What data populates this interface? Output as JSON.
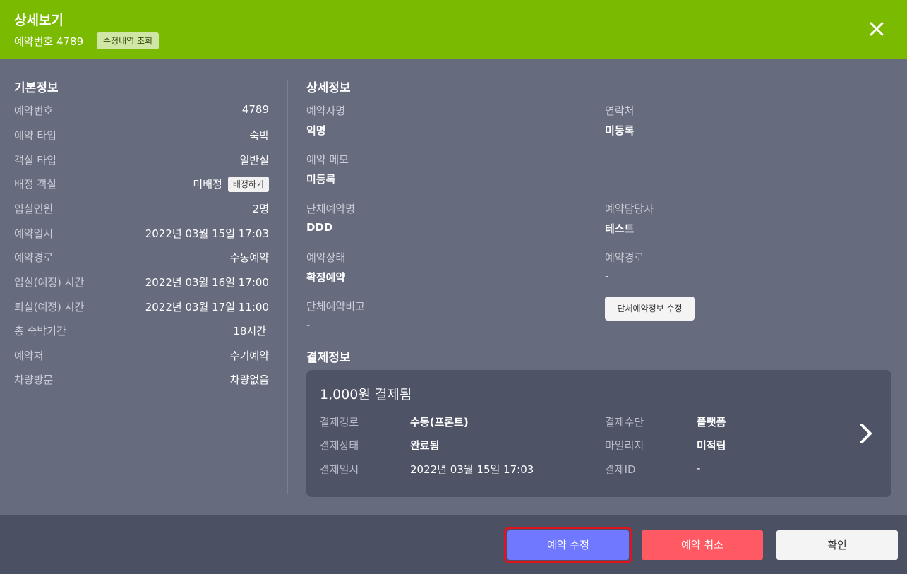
{
  "header": {
    "title": "상세보기",
    "reservation_no_label": "예약번호 4789",
    "history_button": "수정내역 조회",
    "close_icon": "close-icon",
    "accent_color": "#7aba00"
  },
  "basic": {
    "title": "기본정보",
    "rows": [
      {
        "label": "예약번호",
        "value": "4789"
      },
      {
        "label": "예약 타입",
        "value": "숙박"
      },
      {
        "label": "객실 타입",
        "value": "일반실"
      },
      {
        "label": "배정 객실",
        "value": "미배정"
      },
      {
        "label": "입실인원",
        "value": "2명"
      },
      {
        "label": "예약일시",
        "value": "2022년 03월 15일 17:03"
      },
      {
        "label": "예약경로",
        "value": "수동예약"
      },
      {
        "label": "입실(예정) 시간",
        "value": "2022년 03월 16일 17:00"
      },
      {
        "label": "퇴실(예정) 시간",
        "value": "2022년 03월 17일 11:00"
      },
      {
        "label": "총 숙박기간",
        "value": "18시간"
      },
      {
        "label": "예약처",
        "value": "수기예약"
      },
      {
        "label": "차량방문",
        "value": "차량없음"
      }
    ],
    "assign_button": "배정하기"
  },
  "detail": {
    "title": "상세정보",
    "booker_label": "예약자명",
    "booker_value": "익명",
    "contact_label": "연락처",
    "contact_value": "미등록",
    "memo_label": "예약 메모",
    "memo_value": "미등록",
    "group_name_label": "단체예약명",
    "group_name_value": "DDD",
    "manager_label": "예약담당자",
    "manager_value": "테스트",
    "status_label": "예약상태",
    "status_value": "확정예약",
    "route_label": "예약경로",
    "route_value": "-",
    "group_note_label": "단체예약비고",
    "group_note_value": "-",
    "group_edit_button": "단체예약정보 수정"
  },
  "payment": {
    "title": "결제정보",
    "amount": "1,000원 결제됨",
    "route_label": "결제경로",
    "route_value": "수동(프론트)",
    "method_label": "결제수단",
    "method_value": "플랫폼",
    "status_label": "결제상태",
    "status_value": "완료됨",
    "mileage_label": "마일리지",
    "mileage_value": "미적립",
    "date_label": "결제일시",
    "date_value": "2022년 03월 15일 17:03",
    "id_label": "결제ID",
    "id_value": "-",
    "chevron_icon": "chevron-right-icon"
  },
  "footer": {
    "edit_button": "예약 수정",
    "cancel_button": "예약 취소",
    "ok_button": "확인",
    "edit_color": "#6f78ff",
    "cancel_color": "#ff5a63"
  }
}
